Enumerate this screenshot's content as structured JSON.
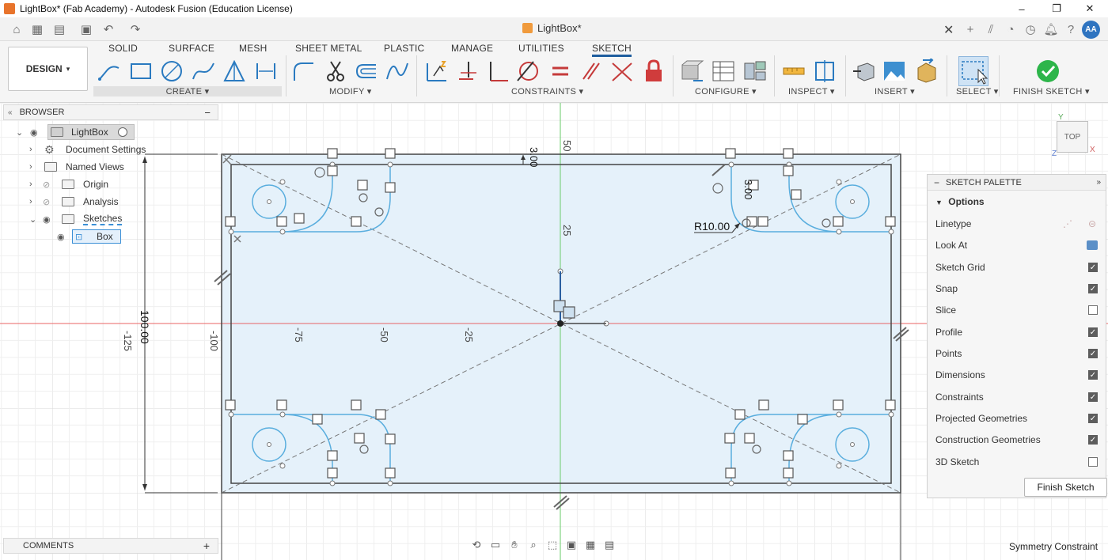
{
  "window": {
    "title": "LightBox* (Fab Academy) - Autodesk Fusion (Education License)",
    "minimize": "–",
    "maximize": "❐",
    "close": "✕"
  },
  "tabbar": {
    "doc_tab": "LightBox*",
    "doc_close": "✕",
    "avatar": "AA"
  },
  "ribbon": {
    "workspace": "DESIGN",
    "workspace_caret": "▾",
    "tabs": [
      "SOLID",
      "SURFACE",
      "MESH",
      "SHEET METAL",
      "PLASTIC",
      "MANAGE",
      "UTILITIES",
      "SKETCH"
    ],
    "groups": [
      "CREATE ▾",
      "MODIFY ▾",
      "CONSTRAINTS ▾",
      "CONFIGURE ▾",
      "INSPECT ▾",
      "INSERT ▾",
      "SELECT ▾",
      "FINISH SKETCH ▾"
    ]
  },
  "browser": {
    "title": "BROWSER",
    "collapse": "−",
    "items": [
      {
        "label": "LightBox"
      },
      {
        "label": "Document Settings"
      },
      {
        "label": "Named Views"
      },
      {
        "label": "Origin"
      },
      {
        "label": "Analysis"
      },
      {
        "label": "Sketches"
      },
      {
        "label": "Box"
      }
    ]
  },
  "comments": {
    "title": "COMMENTS",
    "add": "+"
  },
  "sketch": {
    "dim_radius": "R10.00",
    "dim_height": "100.00",
    "dim_top": "3.00",
    "dim_small": "3.00",
    "ticks_x": [
      "-125",
      "-100",
      "-75",
      "-50",
      "-25"
    ],
    "ticks_y": [
      "50",
      "25"
    ]
  },
  "viewcube": {
    "label": "TOP",
    "axis_y": "Y",
    "axis_x": "X",
    "axis_z": "Z"
  },
  "palette": {
    "title": "SKETCH PALETTE",
    "section": "Options",
    "rows": [
      {
        "label": "Linetype",
        "type": "icons"
      },
      {
        "label": "Look At",
        "type": "icon"
      },
      {
        "label": "Sketch Grid",
        "checked": true
      },
      {
        "label": "Snap",
        "checked": true
      },
      {
        "label": "Slice",
        "checked": false
      },
      {
        "label": "Profile",
        "checked": true
      },
      {
        "label": "Points",
        "checked": true
      },
      {
        "label": "Dimensions",
        "checked": true
      },
      {
        "label": "Constraints",
        "checked": true
      },
      {
        "label": "Projected Geometries",
        "checked": true
      },
      {
        "label": "Construction Geometries",
        "checked": true
      },
      {
        "label": "3D Sketch",
        "checked": false
      }
    ],
    "finish": "Finish Sketch"
  },
  "status": {
    "text": "Symmetry Constraint"
  },
  "colors": {
    "sketch_fill": "#e8f3fb",
    "sketch_line": "#5aaede",
    "axis_red": "#e05454",
    "axis_green": "#5cc46a",
    "accent": "#1e5d9e"
  }
}
